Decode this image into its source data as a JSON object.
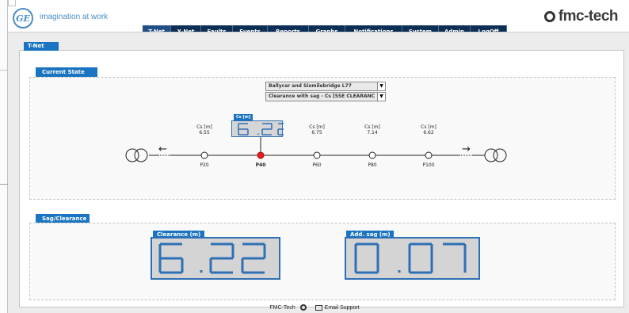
{
  "header": {
    "tagline": "imagination at work",
    "brand_text": "fmc-tech",
    "ge_logo_text": "GE"
  },
  "nav": {
    "items": [
      "T-Net",
      "X-Net",
      "Faults",
      "Events",
      "Reports",
      "Graphs",
      "Notifications",
      "System",
      "Admin",
      "LogOff"
    ],
    "active": "T-Net"
  },
  "page": {
    "tab": "T-Net"
  },
  "current_state": {
    "title": "Current State",
    "line_select": "Ballycar and Sixmilebridge L77",
    "mode_select": "Clearance with sag - Cs [SSE CLEARANC",
    "selected_label": "Cs [m]",
    "selected_value": "6.22",
    "points": [
      {
        "label": "P20",
        "cs_label": "Cs [m]",
        "cs_value": "6.55",
        "selected": false
      },
      {
        "label": "P40",
        "cs_label": "",
        "cs_value": "",
        "selected": true
      },
      {
        "label": "P60",
        "cs_label": "Cs [m]",
        "cs_value": "6.75",
        "selected": false
      },
      {
        "label": "P80",
        "cs_label": "Cs [m]",
        "cs_value": "7.14",
        "selected": false
      },
      {
        "label": "P100",
        "cs_label": "Cs [m]",
        "cs_value": "6.62",
        "selected": false
      }
    ],
    "arrow_left": "←",
    "arrow_right": "→"
  },
  "sag_clearance": {
    "title": "Sag/Clearance",
    "clearance_label": "Clearance (m)",
    "clearance_value": "6.22",
    "sag_label": "Add. sag (m)",
    "sag_value": "0.07"
  },
  "footer": {
    "company": "FMC-Tech",
    "support": "Email Support"
  },
  "colors": {
    "nav_bg": "#0d2f56",
    "accent": "#1b74c1",
    "lcd_digit": "#2f6fb5",
    "selected_point": "#e02020"
  }
}
